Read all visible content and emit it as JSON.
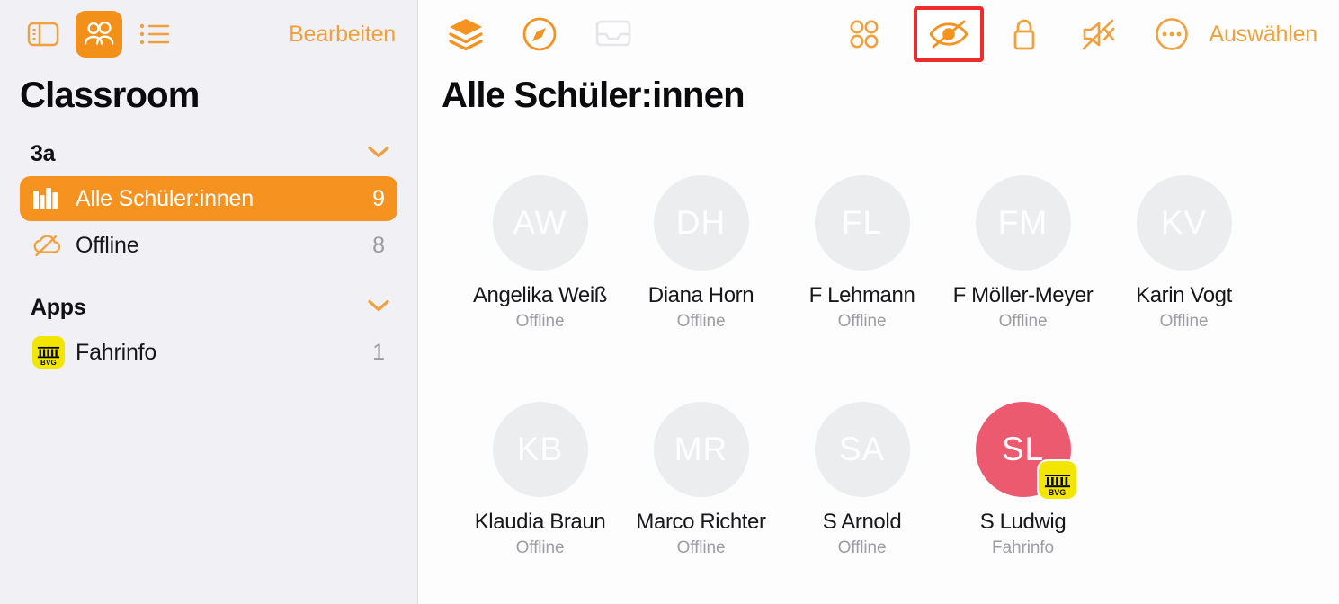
{
  "sidebar": {
    "toolbar": {
      "icons": [
        {
          "name": "sidebar-toggle-icon",
          "label": "Seitenleiste"
        },
        {
          "name": "people-icon",
          "label": "Personen"
        },
        {
          "name": "list-icon",
          "label": "Liste"
        }
      ],
      "edit_label": "Bearbeiten"
    },
    "title": "Classroom",
    "groups": [
      {
        "label": "3a",
        "rows": [
          {
            "icon": "books-icon",
            "label": "Alle Schüler:innen",
            "count": "9",
            "selected": true
          },
          {
            "icon": "cloud-slash-icon",
            "label": "Offline",
            "count": "8",
            "selected": false
          }
        ]
      },
      {
        "label": "Apps",
        "rows": [
          {
            "icon": "bvg-app-icon",
            "label": "Fahrinfo",
            "count": "1",
            "selected": false
          }
        ]
      }
    ]
  },
  "main": {
    "toolbar": {
      "left_icons": [
        {
          "name": "layers-icon",
          "state": "enabled"
        },
        {
          "name": "compass-icon",
          "state": "enabled"
        },
        {
          "name": "inbox-tray-icon",
          "state": "disabled"
        }
      ],
      "right_icons": [
        {
          "name": "grid-four-circles-icon",
          "state": "enabled",
          "highlighted": false
        },
        {
          "name": "eye-slash-icon",
          "state": "enabled",
          "highlighted": true
        },
        {
          "name": "lock-icon",
          "state": "enabled",
          "highlighted": false
        },
        {
          "name": "speaker-mute-icon",
          "state": "enabled",
          "highlighted": false
        },
        {
          "name": "ellipsis-circle-icon",
          "state": "enabled",
          "highlighted": false
        }
      ],
      "select_label": "Auswählen",
      "highlight_color": "#ef2b2b"
    },
    "title": "Alle Schüler:innen",
    "students": [
      {
        "initials": "AW",
        "name": "Angelika Weiß",
        "status": "Offline",
        "active": false,
        "badge": null
      },
      {
        "initials": "DH",
        "name": "Diana Horn",
        "status": "Offline",
        "active": false,
        "badge": null
      },
      {
        "initials": "FL",
        "name": "F Lehmann",
        "status": "Offline",
        "active": false,
        "badge": null
      },
      {
        "initials": "FM",
        "name": "F Möller-Meyer",
        "status": "Offline",
        "active": false,
        "badge": null
      },
      {
        "initials": "KV",
        "name": "Karin Vogt",
        "status": "Offline",
        "active": false,
        "badge": null
      },
      {
        "initials": "KB",
        "name": "Klaudia Braun",
        "status": "Offline",
        "active": false,
        "badge": null
      },
      {
        "initials": "MR",
        "name": "Marco Richter",
        "status": "Offline",
        "active": false,
        "badge": null
      },
      {
        "initials": "SA",
        "name": "S Arnold",
        "status": "Offline",
        "active": false,
        "badge": null
      },
      {
        "initials": "SL",
        "name": "S Ludwig",
        "status": "Fahrinfo",
        "active": true,
        "badge": "bvg-app-icon"
      }
    ]
  },
  "colors": {
    "accent_orange": "#f59220",
    "link_orange": "#f0a03c",
    "active_avatar": "#ec5a70",
    "app_yellow": "#f2e600",
    "highlight_red": "#ef2b2b",
    "sidebar_bg": "#f1f0f5"
  }
}
